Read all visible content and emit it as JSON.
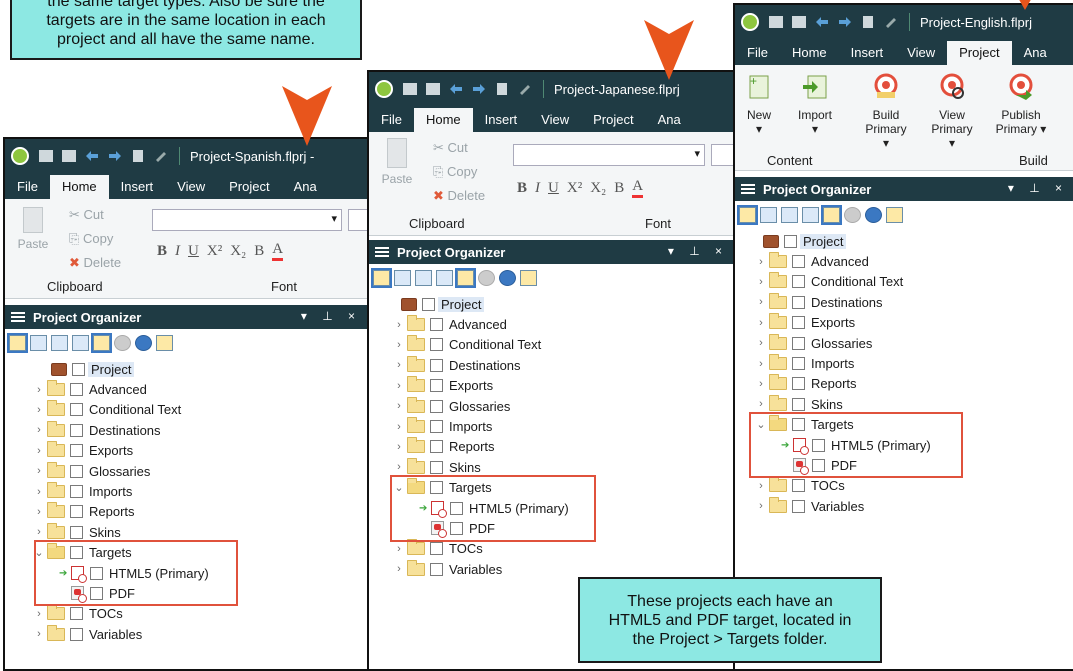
{
  "callouts": {
    "top_left": [
      "the same target types. Also be sure the",
      "targets are in the same location in each",
      "project and all have the same name."
    ],
    "bottom": [
      "These projects each have an",
      "HTML5 and PDF target, located in",
      "the Project > Targets folder."
    ]
  },
  "ribbon_tabs": [
    "File",
    "Home",
    "Insert",
    "View",
    "Project",
    "Ana"
  ],
  "home_ribbon": {
    "paste": "Paste",
    "cut": "Cut",
    "copy": "Copy",
    "delete": "Delete",
    "clipboard_group": "Clipboard",
    "font_group": "Font"
  },
  "project_ribbon": {
    "new": "New",
    "import": "Import",
    "build_primary": [
      "Build",
      "Primary ▾"
    ],
    "view_primary": [
      "View",
      "Primary ▾"
    ],
    "publish_primary": [
      "Publish",
      "Primary ▾"
    ],
    "content_group": "Content",
    "build_group": "Build"
  },
  "panel": {
    "title": "Project Organizer",
    "controls": "▾ ⊥ ×"
  },
  "tree": {
    "root": "Project",
    "folders": [
      "Advanced",
      "Conditional Text",
      "Destinations",
      "Exports",
      "Glossaries",
      "Imports",
      "Reports",
      "Skins"
    ],
    "targets_folder": "Targets",
    "targets": [
      "HTML5 (Primary)",
      "PDF"
    ],
    "after": [
      "TOCs",
      "Variables"
    ]
  },
  "windows": {
    "spanish": {
      "title": "Project-Spanish.flprj -",
      "active_tab": "Home"
    },
    "japanese": {
      "title": "Project-Japanese.flprj",
      "active_tab": "Home"
    },
    "english": {
      "title": "Project-English.flprj",
      "active_tab": "Project"
    }
  },
  "colors": {
    "titlebar": "#1f3b44",
    "callout": "#8de8e3",
    "arrow": "#e8551c",
    "highlight": "#e0523c"
  }
}
